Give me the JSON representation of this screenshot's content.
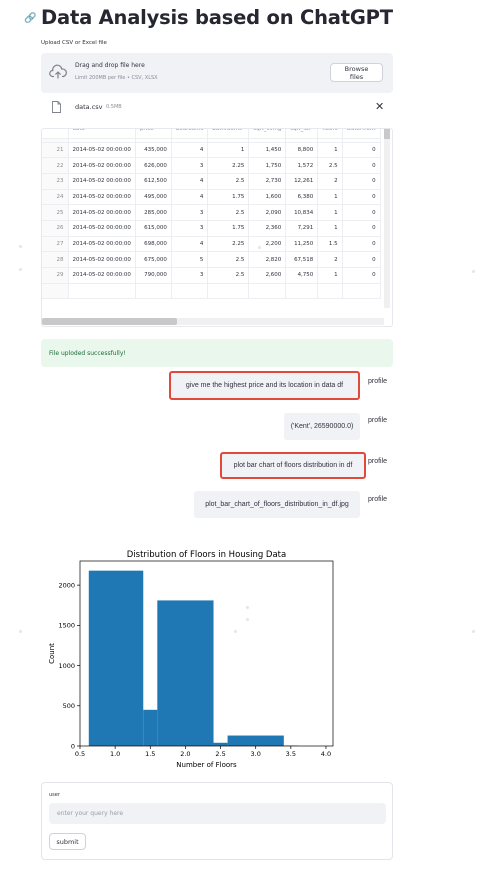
{
  "header": {
    "title": "Data Analysis based on ChatGPT",
    "link_icon": "link-icon"
  },
  "uploader": {
    "label": "Upload CSV or Excel file",
    "drop_title": "Drag and drop file here",
    "drop_subtitle": "Limit 200MB per file • CSV, XLSX",
    "browse_label": "Browse files",
    "file_name": "data.csv",
    "file_size": "0.5MB",
    "icons": {
      "upload": "cloud-upload-icon",
      "file": "file-icon",
      "remove": "close-icon"
    }
  },
  "table": {
    "columns": [
      "",
      "date",
      "price",
      "bedrooms",
      "bathrooms",
      "sqft_living",
      "sqft_lot",
      "floors",
      "waterfront"
    ],
    "rows": [
      [
        "21",
        "2014-05-02 00:00:00",
        "435,000",
        "4",
        "1",
        "1,450",
        "8,800",
        "1",
        "0"
      ],
      [
        "22",
        "2014-05-02 00:00:00",
        "626,000",
        "3",
        "2.25",
        "1,750",
        "1,572",
        "2.5",
        "0"
      ],
      [
        "23",
        "2014-05-02 00:00:00",
        "612,500",
        "4",
        "2.5",
        "2,730",
        "12,261",
        "2",
        "0"
      ],
      [
        "24",
        "2014-05-02 00:00:00",
        "495,000",
        "4",
        "1.75",
        "1,600",
        "6,380",
        "1",
        "0"
      ],
      [
        "25",
        "2014-05-02 00:00:00",
        "285,000",
        "3",
        "2.5",
        "2,090",
        "10,834",
        "1",
        "0"
      ],
      [
        "26",
        "2014-05-02 00:00:00",
        "615,000",
        "3",
        "1.75",
        "2,360",
        "7,291",
        "1",
        "0"
      ],
      [
        "27",
        "2014-05-02 00:00:00",
        "698,000",
        "4",
        "2.25",
        "2,200",
        "11,250",
        "1.5",
        "0"
      ],
      [
        "28",
        "2014-05-02 00:00:00",
        "675,000",
        "5",
        "2.5",
        "2,820",
        "67,518",
        "2",
        "0"
      ],
      [
        "29",
        "2014-05-02 00:00:00",
        "790,000",
        "3",
        "2.5",
        "2,600",
        "4,750",
        "1",
        "0"
      ]
    ]
  },
  "status": {
    "success_message": "File uploded successfully!",
    "success_color": "#e9f7ec"
  },
  "chat": {
    "messages": [
      {
        "text": "give me the highest price and its location in data df",
        "author": "profile",
        "highlighted": true
      },
      {
        "text": "('Kent', 26590000.0)",
        "author": "profile",
        "highlighted": false
      },
      {
        "text": "plot bar chart of floors distribution in df",
        "author": "profile",
        "highlighted": true
      },
      {
        "text": "plot_bar_chart_of_floors_distribution_in_df.jpg",
        "author": "profile",
        "highlighted": false
      }
    ],
    "highlight_color": "#e14a3b"
  },
  "chart_data": {
    "type": "bar",
    "title": "Distribution of Floors in Housing Data",
    "xlabel": "Number of Floors",
    "ylabel": "Count",
    "bins": [
      {
        "x0": 0.625,
        "x1": 1.0,
        "value": 0
      },
      {
        "x0": 0.625,
        "x1": 1.4,
        "value": 2180
      },
      {
        "x0": 1.4,
        "x1": 1.6,
        "value": 450
      },
      {
        "x0": 1.6,
        "x1": 2.4,
        "value": 1810
      },
      {
        "x0": 2.4,
        "x1": 2.6,
        "value": 40
      },
      {
        "x0": 2.6,
        "x1": 3.4,
        "value": 130
      },
      {
        "x0": 3.4,
        "x1": 3.6,
        "value": 5
      }
    ],
    "xlim": [
      0.5,
      4.1
    ],
    "ylim": [
      0,
      2300
    ],
    "xticks": [
      "0.5",
      "1.0",
      "1.5",
      "2.0",
      "2.5",
      "3.0",
      "3.5",
      "4.0"
    ],
    "yticks": [
      "0",
      "500",
      "1000",
      "1500",
      "2000"
    ],
    "bar_color": "#1f77b4",
    "grid": false
  },
  "user_form": {
    "label": "user",
    "placeholder": "enter your query here",
    "submit_label": "submit"
  }
}
